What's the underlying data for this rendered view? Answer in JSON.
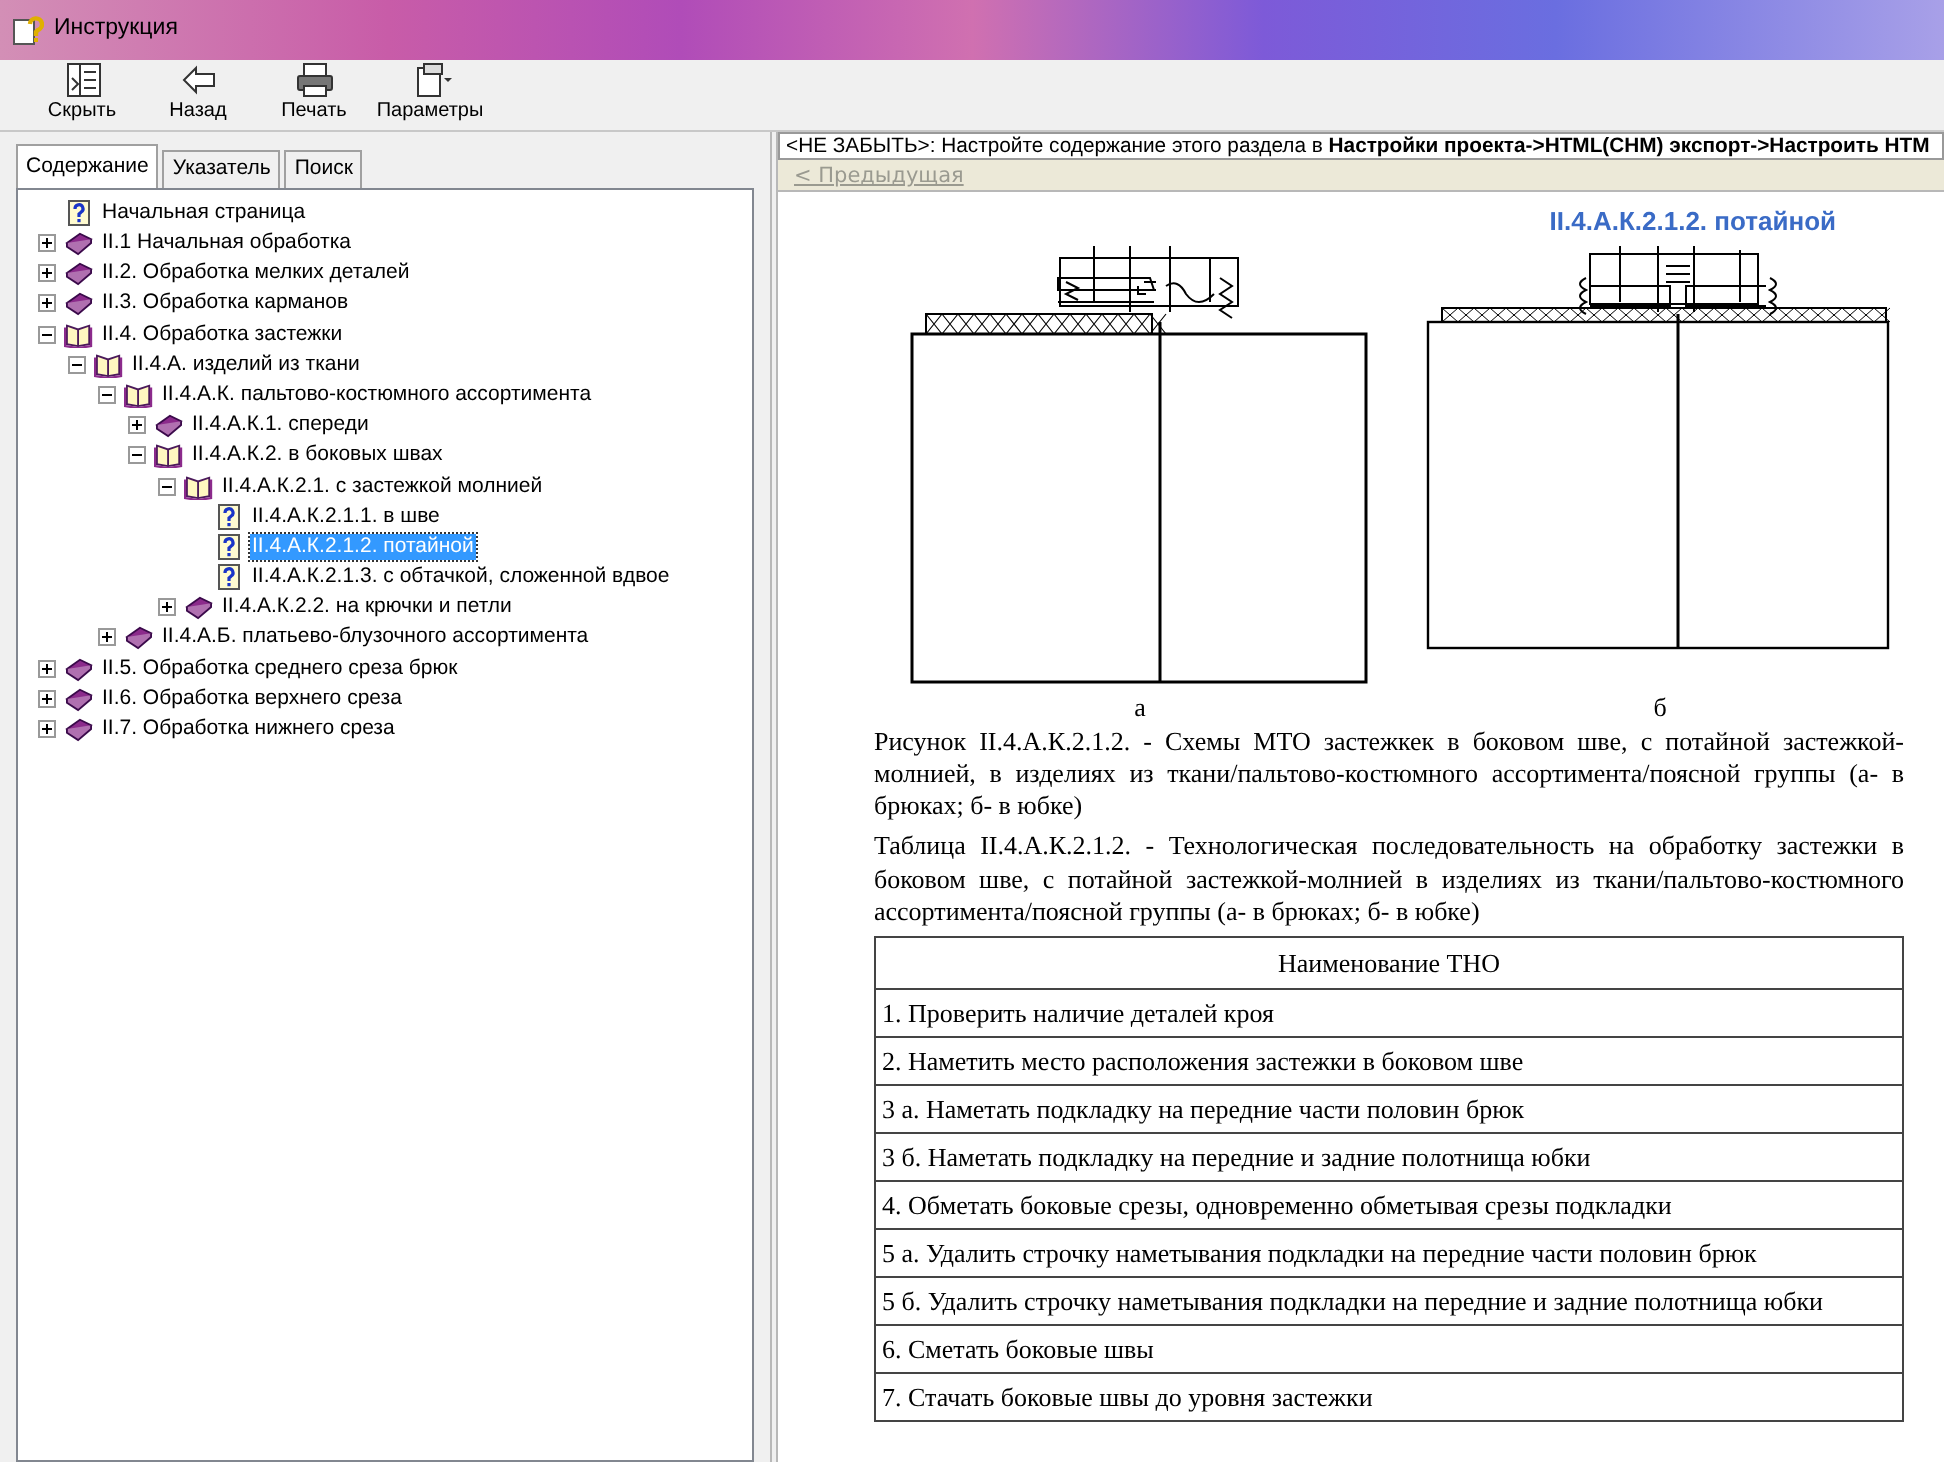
{
  "window": {
    "title": "Инструкция"
  },
  "toolbar": [
    {
      "kind": "hide",
      "label": "Скрыть"
    },
    {
      "kind": "back",
      "label": "Назад"
    },
    {
      "kind": "print",
      "label": "Печать"
    },
    {
      "kind": "options",
      "label": "Параметры"
    }
  ],
  "tabs": [
    {
      "label": "Содержание",
      "selected": true
    },
    {
      "label": "Указатель",
      "selected": false
    },
    {
      "label": "Поиск",
      "selected": false
    }
  ],
  "tree": [
    {
      "kind": "page",
      "label": "Начальная страница",
      "selected": false
    },
    {
      "kind": "book",
      "label": "II.1 Начальная обработка",
      "expanded": false,
      "selected": false
    },
    {
      "kind": "book",
      "label": "II.2. Обработка мелких деталей",
      "expanded": false,
      "selected": false
    },
    {
      "kind": "book",
      "label": "II.3. Обработка карманов",
      "expanded": false,
      "selected": false
    },
    {
      "kind": "book",
      "label": "II.4. Обработка застежки",
      "expanded": true,
      "selected": false,
      "children": [
        {
          "kind": "book",
          "label": "II.4.А. изделий из ткани",
          "expanded": true,
          "selected": false,
          "children": [
            {
              "kind": "book",
              "label": "II.4.А.К. пальтово-костюмного ассортимента",
              "expanded": true,
              "selected": false,
              "children": [
                {
                  "kind": "book",
                  "label": "II.4.А.К.1. спереди",
                  "expanded": false,
                  "selected": false
                },
                {
                  "kind": "book",
                  "label": "II.4.А.К.2. в боковых швах",
                  "expanded": true,
                  "selected": false,
                  "children": [
                    {
                      "kind": "book",
                      "label": "II.4.А.К.2.1. с застежкой молнией",
                      "expanded": true,
                      "selected": false,
                      "children": [
                        {
                          "kind": "page",
                          "label": "II.4.А.К.2.1.1. в шве",
                          "selected": false
                        },
                        {
                          "kind": "page",
                          "label": "II.4.А.К.2.1.2. потайной",
                          "selected": true
                        },
                        {
                          "kind": "page",
                          "label": "II.4.А.К.2.1.3. с обтачкой, сложенной вдвое",
                          "selected": false
                        }
                      ]
                    },
                    {
                      "kind": "book",
                      "label": "II.4.А.К.2.2. на крючки и петли",
                      "expanded": false,
                      "selected": false
                    }
                  ]
                }
              ]
            },
            {
              "kind": "book",
              "label": "II.4.А.Б. платьево-блузочного ассортимента",
              "expanded": false,
              "selected": false
            }
          ]
        }
      ]
    },
    {
      "kind": "book",
      "label": "II.5. Обработка среднего среза брюк",
      "expanded": false,
      "selected": false
    },
    {
      "kind": "book",
      "label": "II.6. Обработка верхнего среза",
      "expanded": false,
      "selected": false
    },
    {
      "kind": "book",
      "label": "II.7. Обработка нижнего среза",
      "expanded": false,
      "selected": false
    }
  ],
  "notice": "<НЕ ЗАБЫТЬ>: Настройте содержание этого раздела в **Настройки проекта->HTML(CHM) экспорт->Настроить HTM**",
  "nav": {
    "prev": {
      "label": "< Предыдущая",
      "disabled": true
    }
  },
  "article": {
    "heading": "II.4.А.К.2.1.2. потайной",
    "figures": [
      {
        "kind": "trousers",
        "label": "а"
      },
      {
        "kind": "skirt",
        "label": "б"
      }
    ],
    "figure_caption": "Рисунок II.4.А.К.2.1.2. - Схемы МТО застежкек в боковом шве, с потайной застежкой-молнией, в изделиях из ткани/пальтово-костюмного ассортимента/поясной группы (а- в брюках; б- в юбке)",
    "table_caption": "Таблица II.4.А.К.2.1.2. - Технологическая последовательность на обработку застежки в боковом шве, с потайной застежкой-молнией в изделиях из ткани/пальтово-костюмного ассортимента/поясной группы (а- в брюках; б- в юбке)",
    "table": {
      "columns": [
        "Наименование ТНО"
      ],
      "rows": [
        "1. Проверить наличие деталей кроя",
        "2. Наметить место расположения застежки в боковом шве",
        "3 а. Наметать подкладку на передние части половин брюк",
        "3 б. Наметать подкладку на передние и задние полотнища юбки",
        "4. Обметать боковые срезы, одновременно обметывая срезы подкладки",
        "5 а. Удалить строчку наметывания подкладки на передние части половин брюк",
        "5 б. Удалить строчку наметывания подкладки на передние и задние полотнища юбки",
        "6. Сметать боковые швы",
        "7. Стачать боковые швы до уровня застежки"
      ]
    }
  }
}
